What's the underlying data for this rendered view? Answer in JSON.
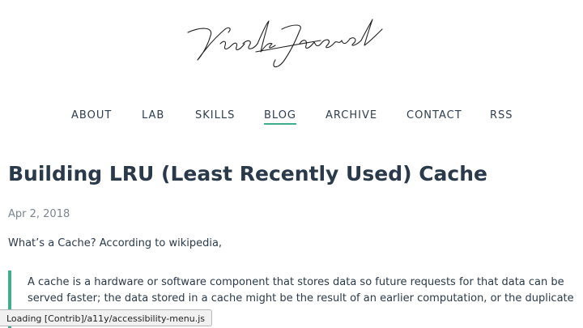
{
  "site": {
    "logo_text": "Vivek Jaiswal"
  },
  "nav": {
    "items": [
      {
        "label": "ABOUT"
      },
      {
        "label": "LAB"
      },
      {
        "label": "SKILLS"
      },
      {
        "label": "BLOG"
      },
      {
        "label": "ARCHIVE"
      },
      {
        "label": "CONTACT"
      },
      {
        "label": "RSS"
      }
    ],
    "active_label": "BLOG"
  },
  "post": {
    "title": "Building LRU (Least Recently Used) Cache",
    "date": "Apr 2, 2018",
    "intro": "What’s a Cache? According to wikipedia,",
    "quote": "A cache is a hardware or software component that stores data so future requests for that data can be served faster; the data stored in a cache might be the result of an earlier computation, or the duplicate of data stored"
  },
  "status": {
    "text": "Loading [Contrib]/a11y/accessibility-menu.js"
  },
  "colors": {
    "accent": "#3fae8f",
    "text": "#2b3a4a",
    "muted": "#7b8590"
  }
}
